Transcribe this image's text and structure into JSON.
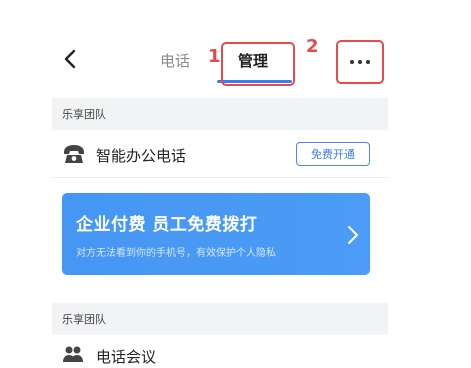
{
  "nav": {
    "back_icon": "chevron-left-icon",
    "tabs": [
      {
        "label": "电话",
        "active": false
      },
      {
        "label": "管理",
        "active": true
      }
    ],
    "more_icon": "more-horizontal-icon"
  },
  "annotations": {
    "callout_1": "1",
    "callout_2": "2",
    "color": "#e84a4a"
  },
  "sections": [
    {
      "header": "乐享团队",
      "items": [
        {
          "icon": "telephone-icon",
          "label": "智能办公电话",
          "action_label": "免费开通"
        }
      ],
      "banner": {
        "title": "企业付费 员工免费拨打",
        "subtitle": "对方无法看到你的手机号，有效保护个人隐私",
        "icon": "chevron-right-icon",
        "color": "#4a9af5"
      }
    },
    {
      "header": "乐享团队",
      "items": [
        {
          "icon": "people-icon",
          "label": "电话会议"
        }
      ]
    }
  ],
  "colors": {
    "accent": "#3b7cf0",
    "section_bg": "#f2f3f5"
  }
}
